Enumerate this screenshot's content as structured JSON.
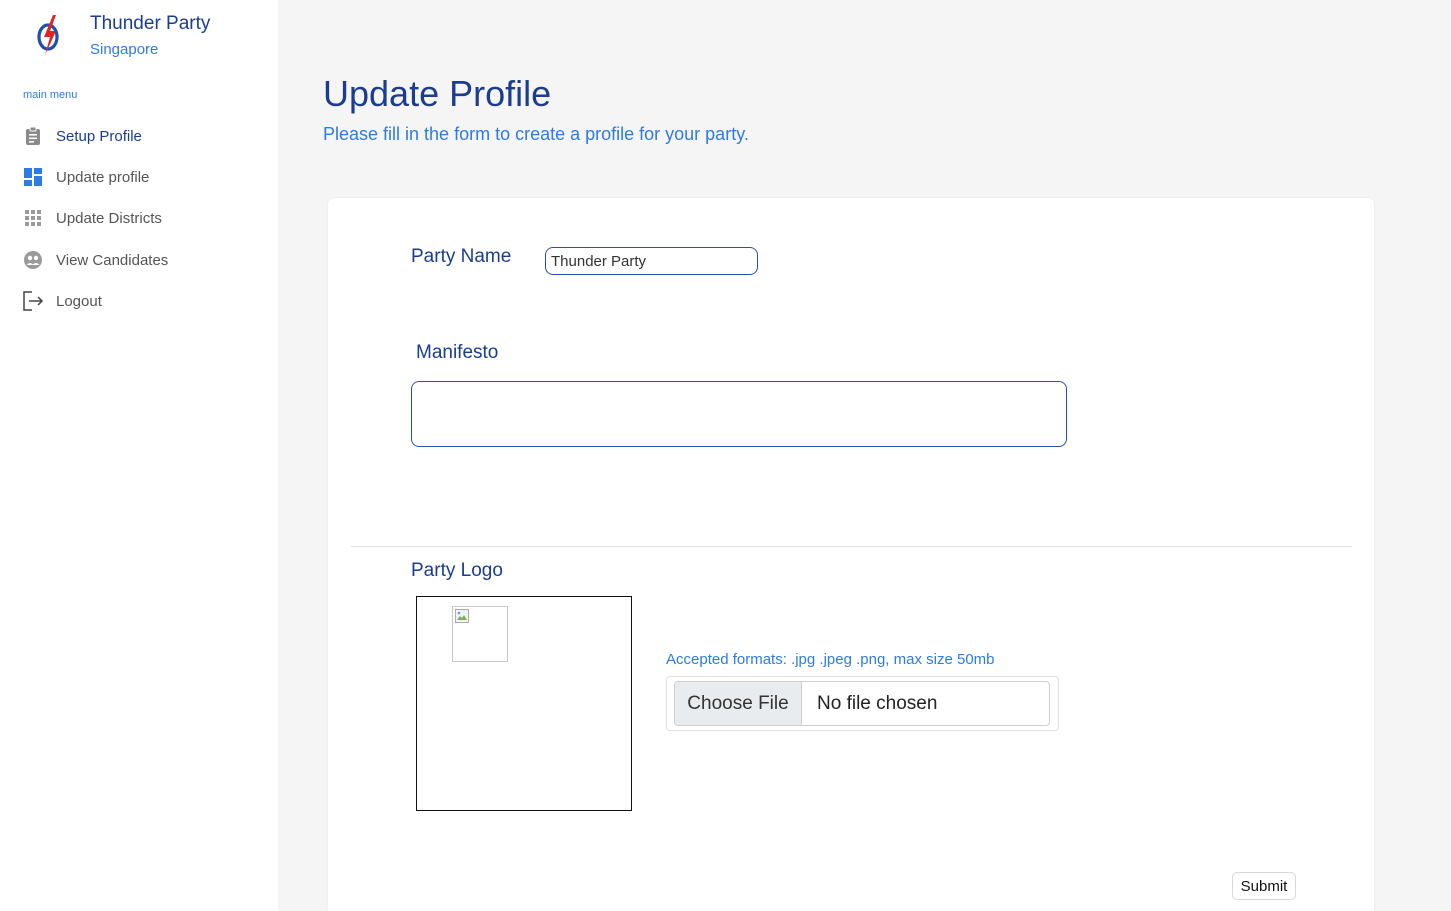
{
  "brand": {
    "name": "Thunder Party",
    "subtitle": "Singapore",
    "logo_icon": "lightning-bolt-logo-icon"
  },
  "sidebar": {
    "caption": "main menu",
    "items": [
      {
        "label": "Setup Profile",
        "icon": "clipboard-icon"
      },
      {
        "label": "Update profile",
        "icon": "dashboard-icon"
      },
      {
        "label": "Update Districts",
        "icon": "grid-icon"
      },
      {
        "label": "View Candidates",
        "icon": "people-icon"
      },
      {
        "label": "Logout",
        "icon": "logout-icon"
      }
    ]
  },
  "page": {
    "title": "Update Profile",
    "subtitle": "Please fill in the form to create a profile for your party."
  },
  "form": {
    "party_name_label": "Party Name",
    "party_name_value": "Thunder Party",
    "manifesto_label": "Manifesto",
    "manifesto_value": "",
    "party_logo_label": "Party Logo",
    "formats_note": "Accepted formats: .jpg .jpeg .png, max size 50mb",
    "choose_file_label": "Choose File",
    "file_status": "No file chosen",
    "submit_label": "Submit"
  },
  "colors": {
    "primary_dark": "#1a3d8f",
    "accent": "#2d7be5",
    "background": "#f5f5f5"
  }
}
